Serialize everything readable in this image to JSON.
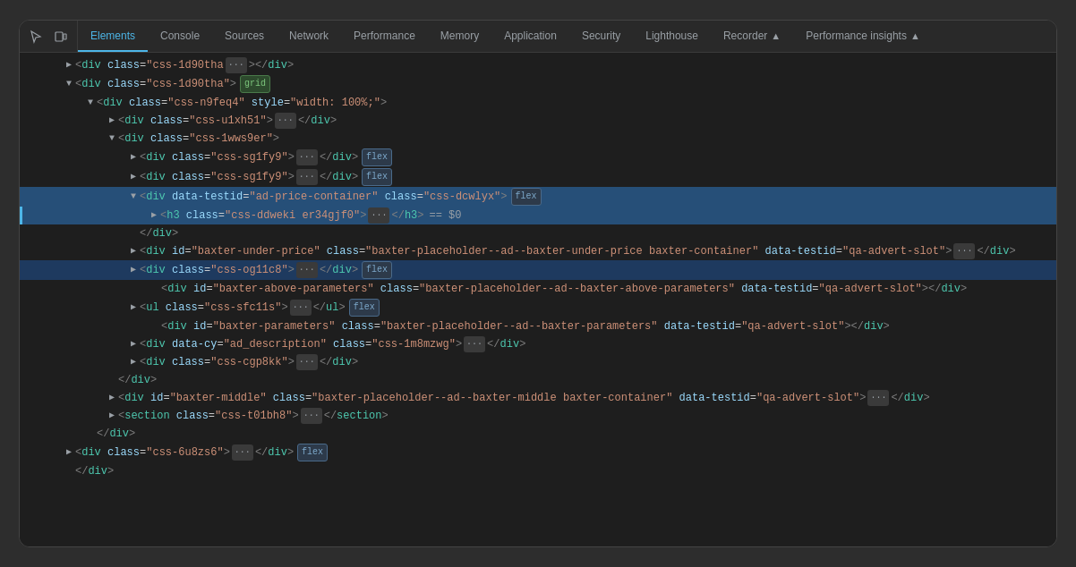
{
  "toolbar": {
    "icons": [
      {
        "name": "cursor-icon",
        "symbol": "⊹"
      },
      {
        "name": "device-icon",
        "symbol": "⬜"
      }
    ],
    "tabs": [
      {
        "id": "elements",
        "label": "Elements",
        "active": true
      },
      {
        "id": "console",
        "label": "Console"
      },
      {
        "id": "sources",
        "label": "Sources"
      },
      {
        "id": "network",
        "label": "Network"
      },
      {
        "id": "performance",
        "label": "Performance"
      },
      {
        "id": "memory",
        "label": "Memory"
      },
      {
        "id": "application",
        "label": "Application"
      },
      {
        "id": "security",
        "label": "Security"
      },
      {
        "id": "lighthouse",
        "label": "Lighthouse"
      },
      {
        "id": "recorder",
        "label": "Recorder",
        "hasIcon": true
      },
      {
        "id": "performance-insights",
        "label": "Performance insights",
        "hasIcon": true
      }
    ]
  },
  "lines": [
    {
      "indent": 4,
      "open": true,
      "partial": true,
      "content": "div_css1d90tha_partial"
    },
    {
      "indent": 4,
      "open": true,
      "content": "div_css1d90tha",
      "badge": "grid"
    },
    {
      "indent": 6,
      "open": true,
      "content": "div_cssn9feq4"
    },
    {
      "indent": 8,
      "open": true,
      "collapsed": true,
      "content": "div_cssu1xh51"
    },
    {
      "indent": 8,
      "open": true,
      "content": "div_css1wws9er"
    },
    {
      "indent": 10,
      "collapsed": true,
      "content": "div_csssg1fy9_1",
      "badge": "flex"
    },
    {
      "indent": 10,
      "collapsed": true,
      "content": "div_csssg1fy9_2",
      "badge": "flex"
    },
    {
      "indent": 10,
      "open": true,
      "content": "div_data_testid_ad",
      "badge": "flex",
      "selected": true
    },
    {
      "indent": 12,
      "open": true,
      "content": "h3_css_ddweki",
      "selected": true,
      "indicator": true
    },
    {
      "indent": 10,
      "content": "close_div"
    },
    {
      "indent": 10,
      "collapsed": true,
      "content": "div_baxter_under"
    },
    {
      "indent": 10,
      "collapsed": true,
      "content": "div_css_og11c8",
      "badge": "flex",
      "selected2": true
    },
    {
      "indent": 12,
      "content": "div_baxter_above"
    },
    {
      "indent": 10,
      "collapsed": true,
      "content": "ul_css_sfc11s",
      "badge": "flex"
    },
    {
      "indent": 12,
      "content": "div_baxter_parameters"
    },
    {
      "indent": 10,
      "collapsed": true,
      "content": "div_data_cy"
    },
    {
      "indent": 10,
      "collapsed": true,
      "content": "div_css_cgp8kk"
    },
    {
      "indent": 8,
      "content": "close_div2"
    },
    {
      "indent": 8,
      "collapsed": true,
      "content": "div_baxter_middle"
    },
    {
      "indent": 8,
      "collapsed": true,
      "content": "section_css_t01bh8"
    },
    {
      "indent": 6,
      "content": "close_div3"
    },
    {
      "indent": 4,
      "collapsed": true,
      "content": "div_css_6u8zs6",
      "badge": "flex"
    },
    {
      "indent": 4,
      "content": "close_div4"
    }
  ]
}
